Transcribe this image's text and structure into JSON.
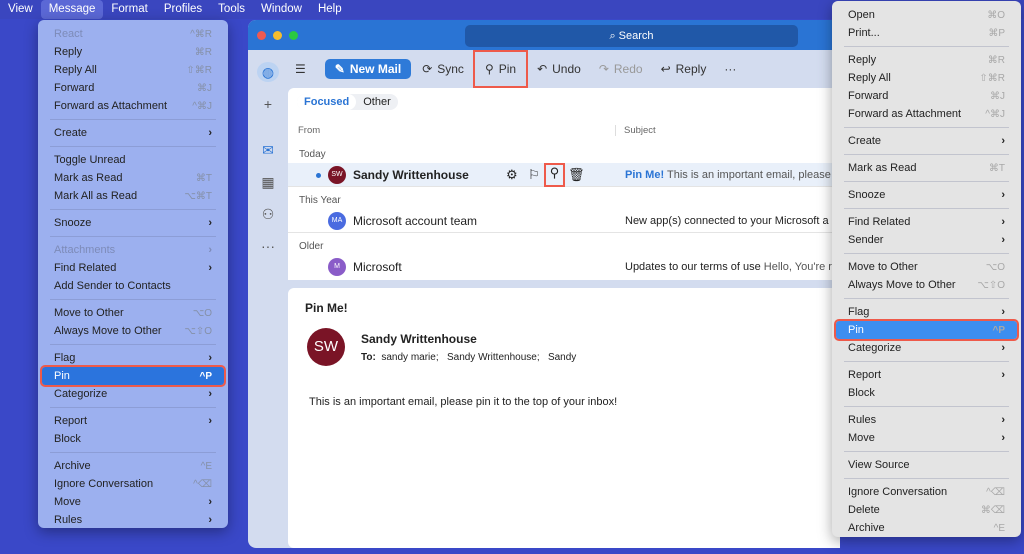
{
  "menubar": [
    "View",
    "Message",
    "Format",
    "Profiles",
    "Tools",
    "Window",
    "Help"
  ],
  "left_menu": [
    [
      {
        "l": "React",
        "s": "^⌘R",
        "d": true
      },
      {
        "l": "Reply",
        "s": "⌘R"
      },
      {
        "l": "Reply All",
        "s": "⇧⌘R"
      },
      {
        "l": "Forward",
        "s": "⌘J"
      },
      {
        "l": "Forward as Attachment",
        "s": "^⌘J"
      }
    ],
    [
      {
        "l": "Create",
        "a": true
      }
    ],
    [
      {
        "l": "Toggle Unread"
      },
      {
        "l": "Mark as Read",
        "s": "⌘T"
      },
      {
        "l": "Mark All as Read",
        "s": "⌥⌘T"
      }
    ],
    [
      {
        "l": "Snooze",
        "a": true
      }
    ],
    [
      {
        "l": "Attachments",
        "a": true,
        "d": true
      },
      {
        "l": "Find Related",
        "a": true
      },
      {
        "l": "Add Sender to Contacts"
      }
    ],
    [
      {
        "l": "Move to Other",
        "s": "⌥O"
      },
      {
        "l": "Always Move to Other",
        "s": "⌥⇧O"
      }
    ],
    [
      {
        "l": "Flag",
        "a": true
      },
      {
        "l": "Pin",
        "s": "^P",
        "h": true
      },
      {
        "l": "Categorize",
        "a": true
      }
    ],
    [
      {
        "l": "Report",
        "a": true
      },
      {
        "l": "Block"
      }
    ],
    [
      {
        "l": "Archive",
        "s": "^E"
      },
      {
        "l": "Ignore Conversation",
        "s": "^⌫"
      },
      {
        "l": "Move",
        "a": true
      },
      {
        "l": "Rules",
        "a": true
      }
    ]
  ],
  "right_menu": [
    [
      {
        "l": "Open",
        "s": "⌘O"
      },
      {
        "l": "Print...",
        "s": "⌘P"
      }
    ],
    [
      {
        "l": "Reply",
        "s": "⌘R"
      },
      {
        "l": "Reply All",
        "s": "⇧⌘R"
      },
      {
        "l": "Forward",
        "s": "⌘J"
      },
      {
        "l": "Forward as Attachment",
        "s": "^⌘J"
      }
    ],
    [
      {
        "l": "Create",
        "a": true
      }
    ],
    [
      {
        "l": "Mark as Read",
        "s": "⌘T"
      }
    ],
    [
      {
        "l": "Snooze",
        "a": true
      }
    ],
    [
      {
        "l": "Find Related",
        "a": true
      },
      {
        "l": "Sender",
        "a": true
      }
    ],
    [
      {
        "l": "Move to Other",
        "s": "⌥O"
      },
      {
        "l": "Always Move to Other",
        "s": "⌥⇧O"
      }
    ],
    [
      {
        "l": "Flag",
        "a": true
      },
      {
        "l": "Pin",
        "s": "^P",
        "h": true
      },
      {
        "l": "Categorize",
        "a": true
      }
    ],
    [
      {
        "l": "Report",
        "a": true
      },
      {
        "l": "Block"
      }
    ],
    [
      {
        "l": "Rules",
        "a": true
      },
      {
        "l": "Move",
        "a": true
      }
    ],
    [
      {
        "l": "View Source"
      }
    ],
    [
      {
        "l": "Ignore Conversation",
        "s": "^⌫"
      },
      {
        "l": "Delete",
        "s": "⌘⌫"
      },
      {
        "l": "Archive",
        "s": "^E"
      }
    ]
  ],
  "window": {
    "search": "Search"
  },
  "toolbar": {
    "new_mail": "New Mail",
    "sync": "Sync",
    "pin": "Pin",
    "undo": "Undo",
    "redo": "Redo",
    "reply": "Reply",
    "more": "···"
  },
  "list": {
    "tabs": {
      "focused": "Focused",
      "other": "Other"
    },
    "columns": {
      "from": "From",
      "subject": "Subject"
    },
    "groups": {
      "today": "Today",
      "this_year": "This Year",
      "older": "Older"
    },
    "rows": [
      {
        "initials": "SW",
        "color": "#7a1426",
        "from": "Sandy Writtenhouse",
        "subject": "Pin Me!",
        "preview": "This is an important email, please pi"
      },
      {
        "initials": "MA",
        "color": "#4a6be0",
        "from": "Microsoft account team",
        "subject": "New app(s) connected to your Microsoft a",
        "preview": ""
      },
      {
        "initials": "M",
        "color": "#8a5cc8",
        "from": "Microsoft",
        "subject": "Updates to our terms of use",
        "preview": "Hello, You're r"
      }
    ]
  },
  "reading": {
    "title": "Pin Me!",
    "initials": "SW",
    "sender": "Sandy Writtenhouse",
    "to_label": "To:",
    "to": "sandy marie;   Sandy Writtenhouse;   Sandy",
    "body": "This is an important email, please pin it to the top of your inbox!"
  }
}
